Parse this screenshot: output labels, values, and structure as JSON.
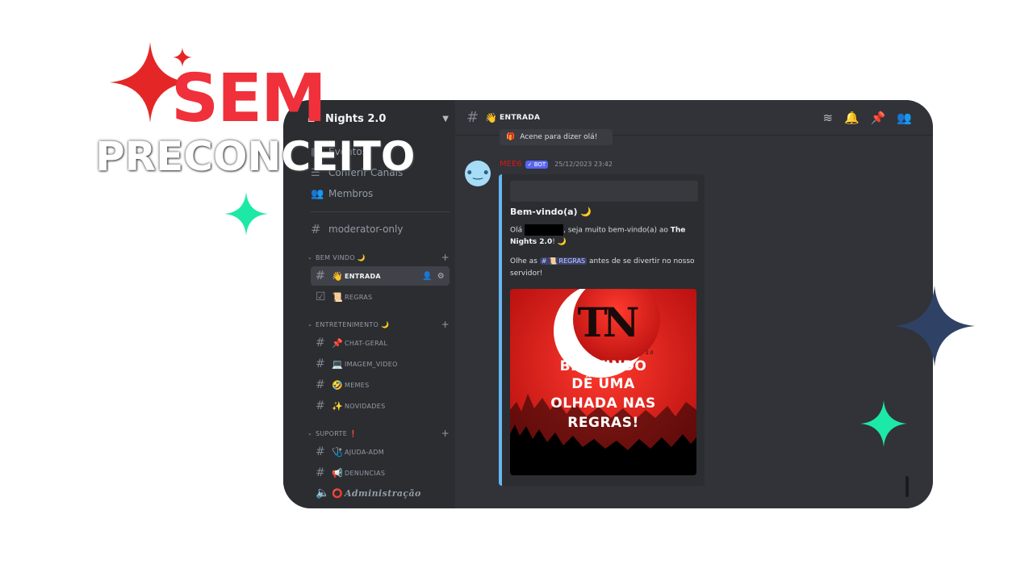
{
  "overlay": {
    "headline_top": "SEM",
    "headline_bottom": "PRECONCEITO",
    "colors": {
      "headline_top": "#f0303a",
      "sparkle_red": "#e42626",
      "sparkle_green": "#1de9a6",
      "sparkle_blue": "#2f4266"
    }
  },
  "server": {
    "name": "Nights 2.0",
    "home_icon": "home-icon",
    "menu_icon": "chevron-down-icon"
  },
  "sidebar": {
    "top_items": [
      {
        "label": "Eventos",
        "icon": "calendar-icon"
      },
      {
        "label": "Conferir Canais",
        "icon": "channels-icon"
      },
      {
        "label": "Membros",
        "icon": "members-icon"
      }
    ],
    "pinned_channel": {
      "label": "moderator-only",
      "icon": "hash-icon"
    },
    "categories": [
      {
        "label": "BEM VINDO 🌙",
        "channels": [
          {
            "emoji": "👋",
            "label": "ENTRADA"
          },
          {
            "emoji": "📜",
            "label": "REGRAS"
          }
        ]
      },
      {
        "label": "ENTRETENIMENTO 🌙",
        "channels": [
          {
            "emoji": "📌",
            "label": "CHAT-GERAL"
          },
          {
            "emoji": "💻",
            "label": "IMAGEM_VIDEO"
          },
          {
            "emoji": "🤣",
            "label": "MEMES"
          },
          {
            "emoji": "✨",
            "label": "NOVIDADES"
          }
        ]
      },
      {
        "label": "SUPORTE ❗",
        "channels": [
          {
            "emoji": "🩺",
            "label": "AJUDA-ADM"
          },
          {
            "emoji": "📢",
            "label": "DENUNCIAS"
          },
          {
            "emoji": "⭕",
            "label": "Administração"
          }
        ]
      }
    ]
  },
  "channel_header": {
    "emoji": "👋",
    "title": "ENTRADA"
  },
  "messages": {
    "wave_button": "Acene para dizer olá!",
    "author": "MEE6",
    "bot_badge": "✓ BOT",
    "timestamp": "25/12/2023 23:42",
    "embed": {
      "title": "Bem-vindo(a) 🌙",
      "line1_pre": "Olá",
      "line1_post": ", seja muito bem-vindo(a) ao",
      "line1_server": "The Nights 2.0",
      "line1_end": "! 🌙",
      "line2_pre": "Olhe as",
      "line2_mention": "# 📜 REGRAS",
      "line2_post": "antes de se divertir no nosso servidor!",
      "poster_logo": "TN",
      "poster_version": "2.0",
      "poster_lines": [
        "BEMVINDO",
        "DÊ UMA",
        "OLHADA NAS",
        "REGRAS!"
      ]
    }
  }
}
